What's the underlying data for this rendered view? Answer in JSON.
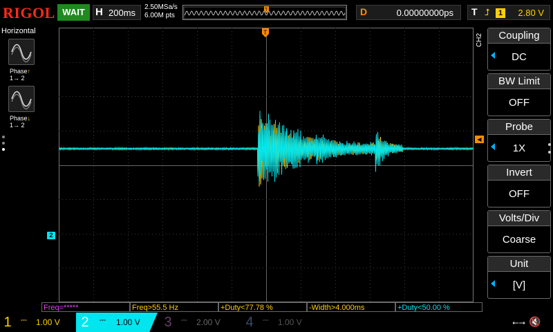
{
  "brand": "RIGOL",
  "run_status": "WAIT",
  "horizontal": {
    "label": "H",
    "timebase": "200ms",
    "sample_rate": "2.50MSa/s",
    "mem_depth": "6.00M pts"
  },
  "delay": {
    "label": "D",
    "value": "0.00000000ps"
  },
  "trigger": {
    "label": "T",
    "edge_icon": "rising-edge-icon",
    "source": "1",
    "level": "2.80 V"
  },
  "left_panel": {
    "title": "Horizontal",
    "items": [
      {
        "label": "Phase",
        "sub": "1→ 2",
        "edge": "rising"
      },
      {
        "label": "Phase",
        "sub": "1→ 2",
        "edge": "falling"
      }
    ]
  },
  "channel_tag": "CH2",
  "menu": [
    {
      "title": "Coupling",
      "value": "DC",
      "arrow": true
    },
    {
      "title": "BW Limit",
      "value": "OFF",
      "arrow": false
    },
    {
      "title": "Probe",
      "value": "1X",
      "arrow": true
    },
    {
      "title": "Invert",
      "value": "OFF",
      "arrow": false
    },
    {
      "title": "Volts/Div",
      "value": "Coarse",
      "arrow": false
    },
    {
      "title": "Unit",
      "value": "[V]",
      "arrow": true
    }
  ],
  "measurements": [
    {
      "text": "Freq=*****",
      "color": "#e040fb"
    },
    {
      "text": "Freq>55.5 Hz",
      "color": "#ffd000"
    },
    {
      "text": "+Duty<77.78 %",
      "color": "#ffd000"
    },
    {
      "text": "-Width>4.000ms",
      "color": "#ffd000"
    },
    {
      "text": "+Duty<50.00 %",
      "color": "#00e5ee"
    }
  ],
  "channels": [
    {
      "num": "1",
      "scale": "1.00 V",
      "color": "#ffd000",
      "active": true
    },
    {
      "num": "2",
      "scale": "1.00 V",
      "color": "#00e5ee",
      "active": true,
      "selected": true
    },
    {
      "num": "3",
      "scale": "2.00 V",
      "color": "#6a3d6a",
      "active": false
    },
    {
      "num": "4",
      "scale": "1.00 V",
      "color": "#3a4a6a",
      "active": false
    }
  ],
  "ch2_marker": "2",
  "colors": {
    "ch1": "#ffd000",
    "ch2": "#00e5ee",
    "trigger": "#ff8c00",
    "brand": "#ff2a1a",
    "run": "#1f8a1f"
  }
}
